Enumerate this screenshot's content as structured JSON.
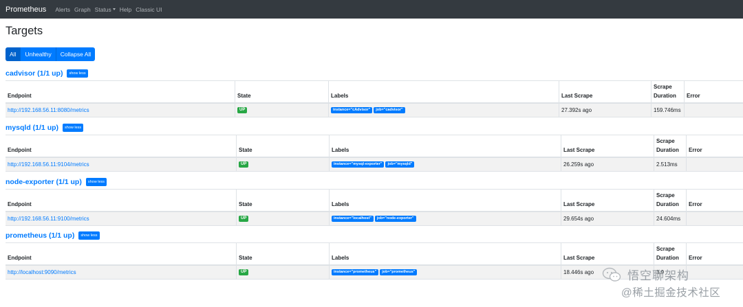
{
  "navbar": {
    "brand": "Prometheus",
    "links": [
      "Alerts",
      "Graph",
      "Status",
      "Help",
      "Classic UI"
    ]
  },
  "page_title": "Targets",
  "filters": [
    "All",
    "Unhealthy",
    "Collapse All"
  ],
  "columns": {
    "endpoint": "Endpoint",
    "state": "State",
    "labels": "Labels",
    "last_scrape": "Last Scrape",
    "scrape_duration_1": "Scrape",
    "scrape_duration_2": "Duration",
    "error": "Error"
  },
  "targets": [
    {
      "title": "cadvisor (1/1 up)",
      "toggle": "show less",
      "endpoint": "http://192.168.56.11:8080/metrics",
      "state": "UP",
      "labels": [
        "instance=\"cAdvisor\"",
        "job=\"cadvisor\""
      ],
      "last_scrape": "27.392s ago",
      "duration": "159.746ms",
      "error": ""
    },
    {
      "title": "mysqld (1/1 up)",
      "toggle": "show less",
      "endpoint": "http://192.168.56.11:9104/metrics",
      "state": "UP",
      "labels": [
        "instance=\"mysql-exporter\"",
        "job=\"mysqld\""
      ],
      "last_scrape": "26.259s ago",
      "duration": "2.513ms",
      "error": ""
    },
    {
      "title": "node-exporter (1/1 up)",
      "toggle": "show less",
      "endpoint": "http://192.168.56.11:9100/metrics",
      "state": "UP",
      "labels": [
        "instance=\"localhost\"",
        "job=\"node-exporter\""
      ],
      "last_scrape": "29.654s ago",
      "duration": "24.604ms",
      "error": ""
    },
    {
      "title": "prometheus (1/1 up)",
      "toggle": "show less",
      "endpoint": "http://localhost:9090/metrics",
      "state": "UP",
      "labels": [
        "instance=\"prometheus\"",
        "job=\"prometheus\""
      ],
      "last_scrape": "18.446s ago",
      "duration": "3.9",
      "error": ""
    }
  ],
  "watermark": {
    "line1": "悟空聊架构",
    "line2": "@稀土掘金技术社区"
  }
}
